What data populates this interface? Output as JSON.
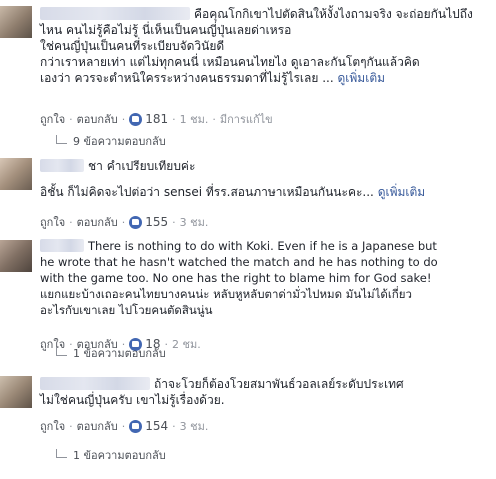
{
  "comments": [
    {
      "lines": [
        "คือคุณโกกิเขาไปตัดสินให้งั้งไงถามจริง จะถ่อยกันไปถึง",
        "ไหน คนไม่รู้คือไม่รู้ นี่เห็นเป็นคนญี่ปุ่นเลยด่าเหรอ",
        "ใช่คนญี่ปุ่นเป็นคนที่ระเบียบจัดวินัยดี",
        "กว่าเราหลายเท่า แต่ไม่ทุกคนนี่ เหมือนคนไทยไง ดูเอาละกันโตๆกันแล้วคิด",
        "เองว่า ควรจะตำหนิใครระหว่างคนธรรมดาที่ไม่รู้ไรเลย ..."
      ],
      "more": "ดูเพิ่มเติม",
      "like_label": "ถูกใจ",
      "reply_label": "ตอบกลับ",
      "likes": "181",
      "time": "1 ชม.",
      "edited": "มีการแก้ไข",
      "replies": "9 ข้อความตอบกลับ"
    },
    {
      "lines": [
        "ชา คำเปรียบเทียบค่ะ",
        "อิชั้น ก็ไม่คิดจะไปต่อว่า sensei ที่รร.สอนภาษาเหมือนกันนะคะ..."
      ],
      "more": "ดูเพิ่มเติม",
      "like_label": "ถูกใจ",
      "reply_label": "ตอบกลับ",
      "likes": "155",
      "time": "3 ชม."
    },
    {
      "lines": [
        "There is nothing to do with Koki. Even if he is a Japanese but",
        "he wrote that he hasn't watched the match and he has nothing to do",
        "with the game too. No one has the right to blame him for God sake!",
        "แยกแยะบ้างเถอะคนไทยบางคนน่ะ หลับหูหลับตาด่ามั่วไปหมด มันไม่ได้เกี่ยว",
        "อะไรกับเขาเลย ไปโวยคนตัดสินนู่น"
      ],
      "like_label": "ถูกใจ",
      "reply_label": "ตอบกลับ",
      "likes": "18",
      "time": "2 ชม."
    },
    {
      "lines": [
        "ถ้าจะโวยก็ต้องโวยสมาพันธ์วอลเลย์ระดับประเทศ",
        "ไม่ใช่คนญี่ปุ่นครับ เขาไม่รู้เรื่องด้วย."
      ],
      "like_label": "ถูกใจ",
      "reply_label": "ตอบกลับ",
      "likes": "154",
      "time": "3 ชม.",
      "replies": "1 ข้อความตอบกลับ"
    }
  ],
  "top_replies": "1 ข้อความตอบกลับ"
}
